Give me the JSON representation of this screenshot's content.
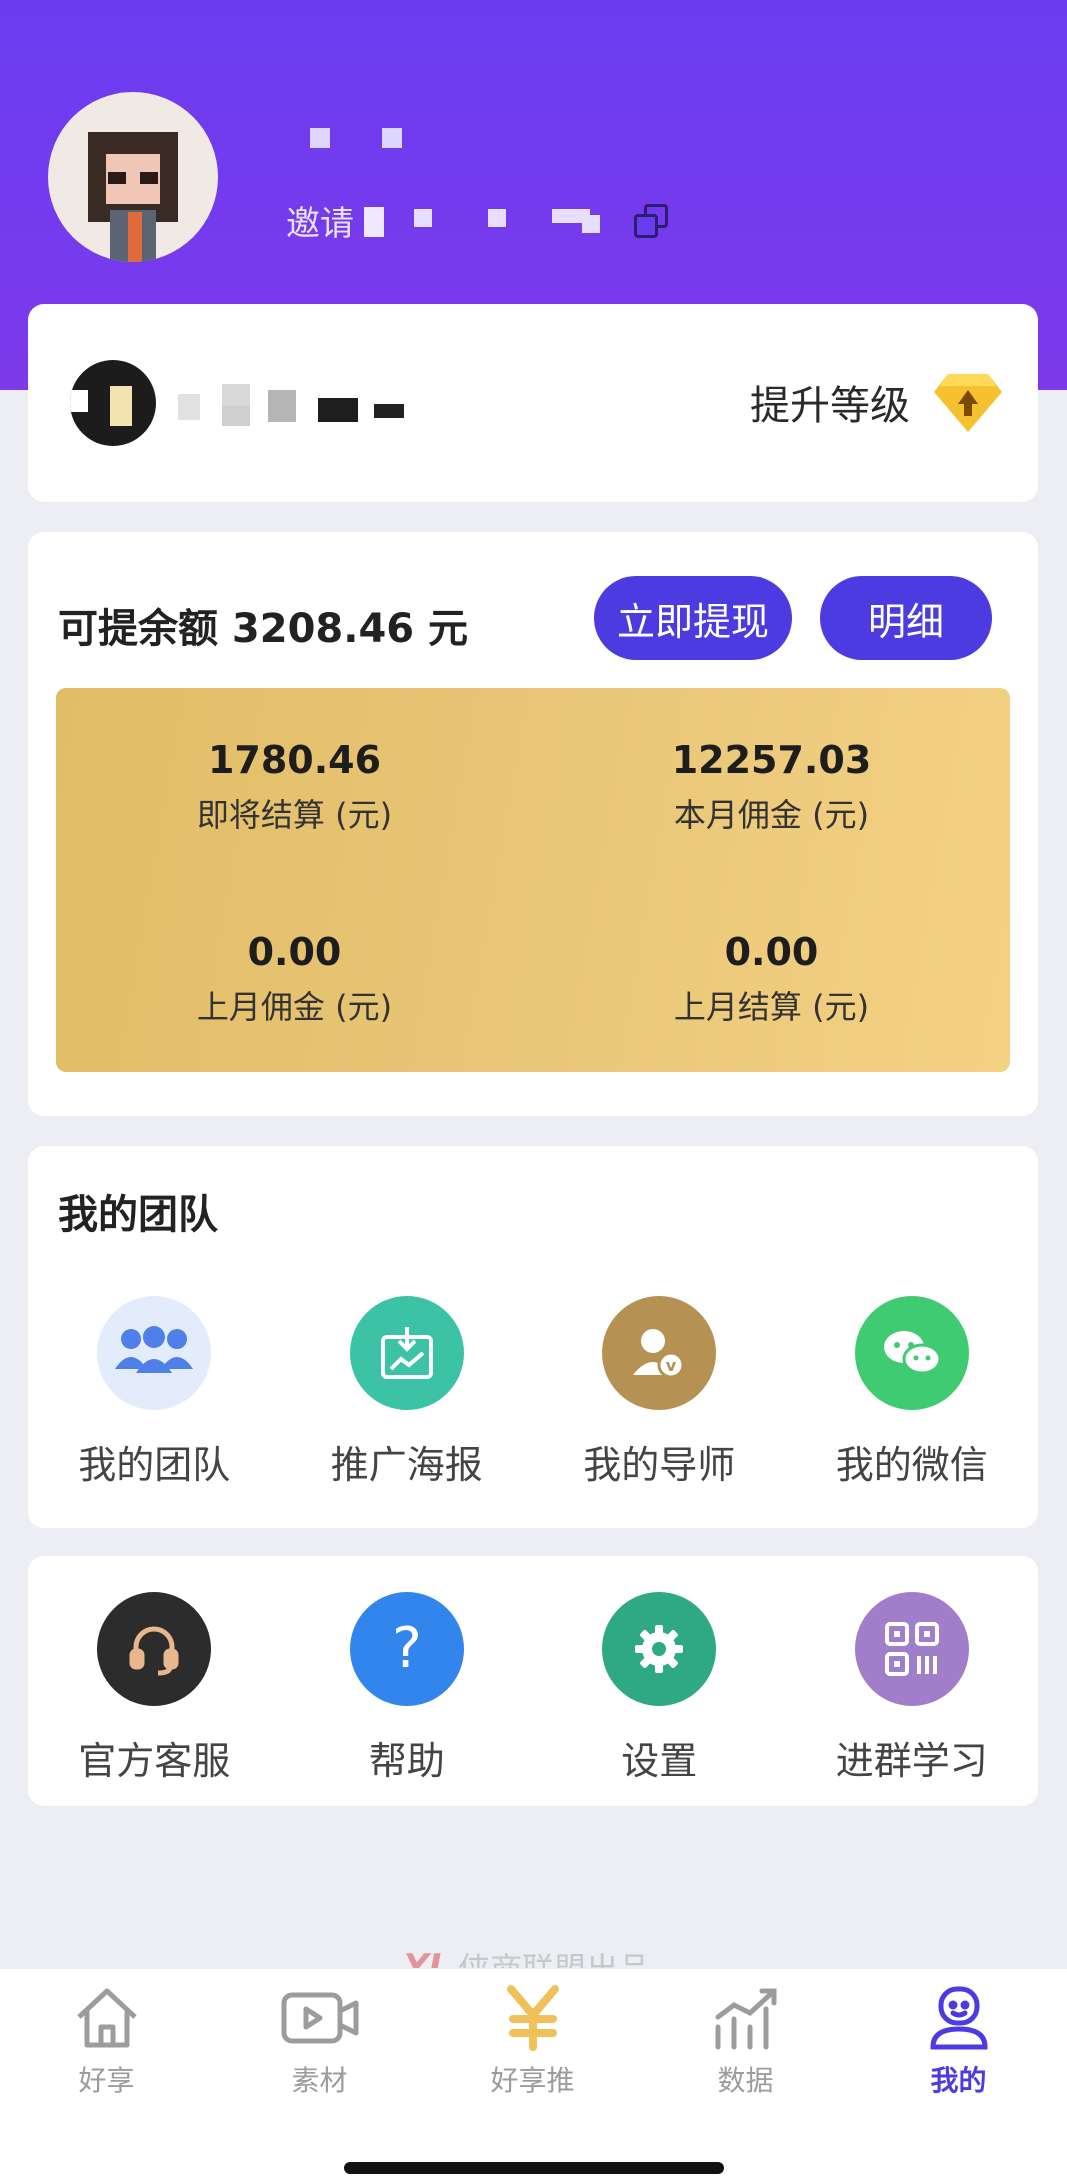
{
  "profile": {
    "invite_label": "邀请",
    "upgrade_label": "提升等级"
  },
  "balance": {
    "label": "可提余额 3208.46 元",
    "withdraw_label": "立即提现",
    "detail_label": "明细",
    "stats": [
      {
        "value": "1780.46",
        "label": "即将结算 (元)"
      },
      {
        "value": "12257.03",
        "label": "本月佣金 (元)"
      },
      {
        "value": "0.00",
        "label": "上月佣金 (元)"
      },
      {
        "value": "0.00",
        "label": "上月结算 (元)"
      }
    ]
  },
  "team": {
    "title": "我的团队",
    "items": [
      {
        "label": "我的团队",
        "icon": "team-icon"
      },
      {
        "label": "推广海报",
        "icon": "poster-download-icon"
      },
      {
        "label": "我的导师",
        "icon": "mentor-icon"
      },
      {
        "label": "我的微信",
        "icon": "wechat-icon"
      }
    ]
  },
  "tools": {
    "items": [
      {
        "label": "官方客服",
        "icon": "headset-icon"
      },
      {
        "label": "帮助",
        "icon": "help-icon"
      },
      {
        "label": "设置",
        "icon": "gear-icon"
      },
      {
        "label": "进群学习",
        "icon": "qr-code-icon"
      }
    ]
  },
  "footer": {
    "brand_logo": "YL",
    "brand_text": "侠商联盟出品"
  },
  "tabs": [
    {
      "label": "好享",
      "icon": "home-icon",
      "active": false
    },
    {
      "label": "素材",
      "icon": "video-icon",
      "active": false
    },
    {
      "label": "好享推",
      "icon": "yuan-icon",
      "active": false
    },
    {
      "label": "数据",
      "icon": "chart-icon",
      "active": false
    },
    {
      "label": "我的",
      "icon": "profile-icon",
      "active": true
    }
  ],
  "colors": {
    "accent": "#4b3be0",
    "header": "#6a3cf0",
    "gold": "#e9c778"
  }
}
